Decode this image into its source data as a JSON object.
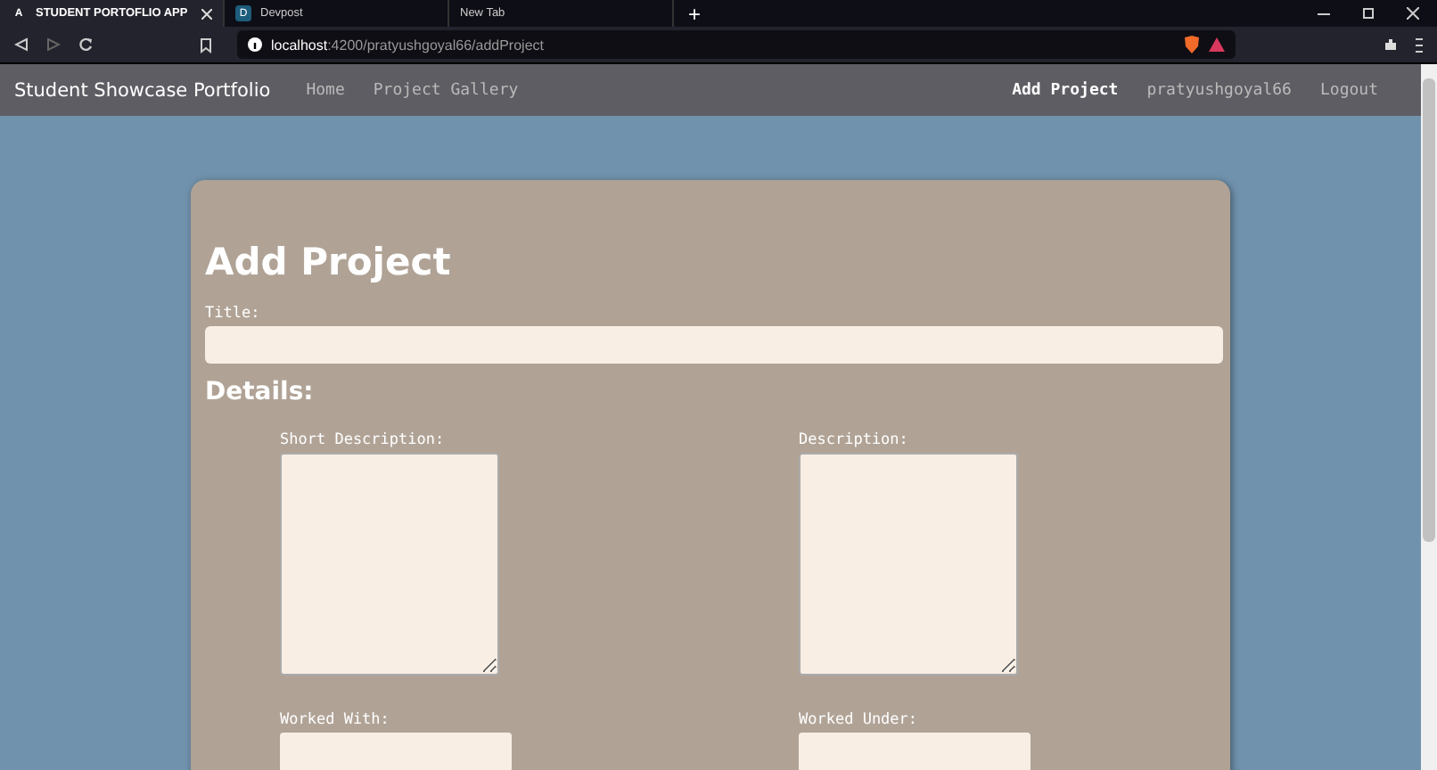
{
  "browser": {
    "tabs": [
      {
        "label": "STUDENT PORTOFLIO APP",
        "favicon": "A",
        "selected": true
      },
      {
        "label": "Devpost",
        "favicon": "D",
        "selected": false
      },
      {
        "label": "New Tab",
        "selected": false
      }
    ],
    "new_tab": "+",
    "address": {
      "host": "localhost",
      "rest": ":4200/pratyushgoyal66/addProject"
    }
  },
  "navbar": {
    "brand": "Student Showcase Portfolio",
    "left": [
      {
        "label": "Home",
        "selected": false
      },
      {
        "label": "Project Gallery",
        "selected": false
      }
    ],
    "right": [
      {
        "label": "Add Project",
        "selected": true
      },
      {
        "label": "pratyushgoyal66",
        "selected": false
      },
      {
        "label": "Logout",
        "selected": false
      }
    ]
  },
  "form": {
    "heading": "Add Project",
    "title_label": "Title:",
    "section": "Details:",
    "textareas": [
      {
        "label": "Short Description:"
      },
      {
        "label": "Description:"
      }
    ],
    "inputs": [
      {
        "label": "Worked With:"
      },
      {
        "label": "Worked Under:"
      }
    ]
  }
}
